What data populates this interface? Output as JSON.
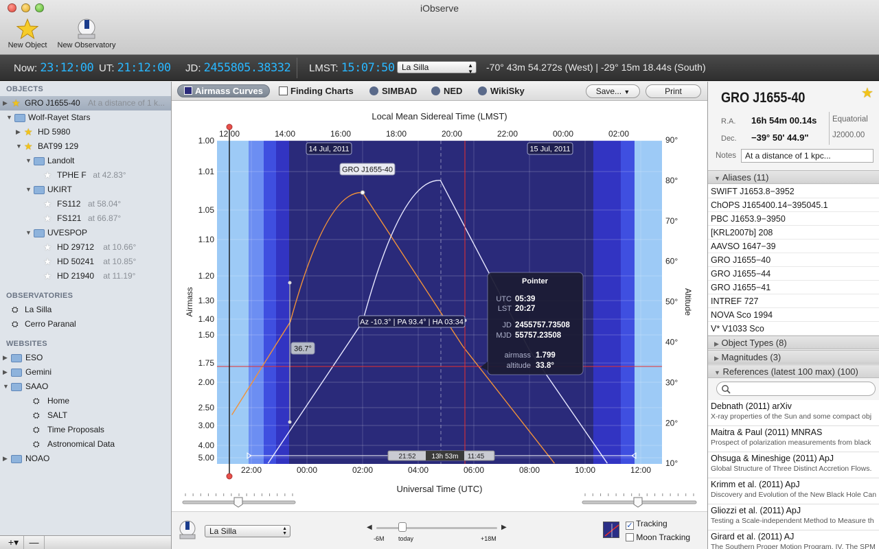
{
  "window": {
    "title": "iObserve"
  },
  "toolbar": {
    "new_object": "New Object",
    "new_observatory": "New Observatory"
  },
  "timebar": {
    "now_label": "Now:",
    "now_value": "23:12:00",
    "ut_label": "UT:",
    "ut_value": "21:12:00",
    "jd_label": "JD:",
    "jd_value": "2455805.38332",
    "lmst_label": "LMST:",
    "lmst_value": "15:07:50",
    "observatory": "La Silla",
    "coordinates": "-70° 43m 54.272s (West) | -29° 15m 18.44s (South)"
  },
  "sidebar": {
    "objects_header": "OBJECTS",
    "selected": {
      "name": "GRO J1655-40",
      "note": "At a distance of 1 k..."
    },
    "tree": [
      {
        "label": "Wolf-Rayet Stars",
        "kind": "folder",
        "indent": 0,
        "extra": ""
      },
      {
        "label": "HD 5980",
        "kind": "star-y",
        "indent": 1,
        "extra": ""
      },
      {
        "label": "BAT99 129",
        "kind": "star-y",
        "indent": 1,
        "extra": ""
      },
      {
        "label": "Landolt",
        "kind": "folder",
        "indent": 2,
        "extra": ""
      },
      {
        "label": "TPHE F",
        "kind": "star-w",
        "indent": 3,
        "extra": "at 42.83°"
      },
      {
        "label": "UKIRT",
        "kind": "folder",
        "indent": 2,
        "extra": ""
      },
      {
        "label": "FS112",
        "kind": "star-w",
        "indent": 3,
        "extra": "at 58.04°"
      },
      {
        "label": "FS121",
        "kind": "star-w",
        "indent": 3,
        "extra": "at 66.87°"
      },
      {
        "label": "UVESPOP",
        "kind": "folder",
        "indent": 2,
        "extra": ""
      },
      {
        "label": "HD 29712",
        "kind": "star-w",
        "indent": 3,
        "extra": "at 10.66°"
      },
      {
        "label": "HD 50241",
        "kind": "star-w",
        "indent": 3,
        "extra": "at 10.85°"
      },
      {
        "label": "HD 21940",
        "kind": "star-w",
        "indent": 3,
        "extra": "at 11.19°"
      }
    ],
    "observatories_header": "OBSERVATORIES",
    "observatories": [
      "La Silla",
      "Cerro Paranal"
    ],
    "websites_header": "WEBSITES",
    "websites": [
      {
        "label": "ESO",
        "kind": "folder",
        "indent": 0
      },
      {
        "label": "Gemini",
        "kind": "folder",
        "indent": 0
      },
      {
        "label": "SAAO",
        "kind": "folder",
        "indent": 0
      },
      {
        "label": "Home",
        "kind": "page",
        "indent": 1
      },
      {
        "label": "SALT",
        "kind": "page",
        "indent": 1
      },
      {
        "label": "Time Proposals",
        "kind": "page",
        "indent": 1
      },
      {
        "label": "Astronomical Data",
        "kind": "page",
        "indent": 1
      },
      {
        "label": "NOAO",
        "kind": "folder",
        "indent": 0
      }
    ],
    "add_label": "+▾",
    "remove_label": "—"
  },
  "center_toolbar": {
    "airmass": "Airmass Curves",
    "finding": "Finding Charts",
    "simbad": "SIMBAD",
    "ned": "NED",
    "wikisky": "WikiSky",
    "save": "Save...",
    "print": "Print"
  },
  "chart_data": {
    "type": "line",
    "title": "Local Mean Sidereal Time (LMST)",
    "xlabel": "Universal Time (UTC)",
    "ylabel_left": "Airmass",
    "ylabel_right": "Altitude",
    "x_ticks_bottom": [
      "22:00",
      "00:00",
      "02:00",
      "04:00",
      "06:00",
      "08:00",
      "10:00",
      "12:00"
    ],
    "x_ticks_top": [
      "12:00",
      "14:00",
      "16:00",
      "18:00",
      "20:00",
      "22:00",
      "00:00",
      "02:00"
    ],
    "airmass_ticks": [
      "1.00",
      "1.01",
      "1.05",
      "1.10",
      "1.20",
      "1.30",
      "1.40",
      "1.50",
      "1.75",
      "2.00",
      "2.50",
      "3.00",
      "4.00",
      "5.00"
    ],
    "altitude_ticks": [
      "90°",
      "80°",
      "70°",
      "60°",
      "50°",
      "40°",
      "30°",
      "20°",
      "10°"
    ],
    "date_labels": [
      "14 Jul, 2011",
      "15 Jul, 2011"
    ],
    "series": [
      {
        "name": "GRO J1655-40",
        "color": "#f0923a",
        "peak_utc": "02:00",
        "peak_altitude": 77,
        "points": [
          [
            21.3,
            22
          ],
          [
            23.4,
            45
          ],
          [
            2.0,
            77
          ],
          [
            5.6,
            39
          ],
          [
            8.9,
            10
          ]
        ]
      },
      {
        "color": "#e8e8ff",
        "peak_utc": "04:50",
        "peak_altitude": 80,
        "points": [
          [
            22.6,
            10
          ],
          [
            2.0,
            45
          ],
          [
            4.8,
            80
          ],
          [
            8.0,
            38
          ],
          [
            10.8,
            10
          ]
        ]
      }
    ],
    "target_label": "GRO J1655-40",
    "pointer": {
      "title": "Pointer",
      "utc": "05:39",
      "lst": "20:27",
      "jd": "2455757.73508",
      "mjd": "55757.23508",
      "airmass": "1.799",
      "altitude": "33.8°"
    },
    "pointer_info": "Az -10.3° | PA 93.4° | HA 03:34",
    "angle_label": "36.7°",
    "night_span": {
      "start": "21:52",
      "length": "13h 53m",
      "end": "11:45"
    },
    "colors": {
      "night": "#2a2a7a",
      "twilight": "#3f4fe0",
      "day": "#9dcaf6",
      "cursor": "#e8302e"
    }
  },
  "bottom_controls": {
    "observatory": "La Silla",
    "minus_label": "-6M",
    "today_label": "today",
    "plus_label": "+18M",
    "tracking_label": "Tracking",
    "tracking_checked": true,
    "moon_tracking_label": "Moon Tracking",
    "moon_tracking_checked": false
  },
  "right_panel": {
    "object_name": "GRO J1655-40",
    "ra_label": "R.A.",
    "ra_value": "16h 54m 00.14s",
    "dec_label": "Dec.",
    "dec_value": "−39° 50' 44.9\"",
    "frame": "Equatorial",
    "epoch": "J2000.00",
    "notes_label": "Notes",
    "notes_value": "At a distance of 1 kpc...",
    "aliases_header": "Aliases (11)",
    "aliases": [
      "SWIFT J1653.8−3952",
      "ChOPS J165400.14−395045.1",
      "PBC J1653.9−3950",
      "[KRL2007b] 208",
      "AAVSO 1647−39",
      "GRO J1655−40",
      "GRO J1655−44",
      "GRO J1655−41",
      "INTREF  727",
      "NOVA Sco 1994",
      "V* V1033 Sco"
    ],
    "object_types_header": "Object Types (8)",
    "magnitudes_header": "Magnitudes (3)",
    "references_header": "References (latest 100 max) (100)",
    "references": [
      {
        "title": "Debnath (2011) arXiv",
        "subtitle": "X-ray properties of the Sun and some compact obj"
      },
      {
        "title": "Maitra & Paul (2011) MNRAS",
        "subtitle": "Prospect of polarization measurements from black"
      },
      {
        "title": "Ohsuga & Mineshige (2011) ApJ",
        "subtitle": "Global Structure of Three Distinct Accretion Flows."
      },
      {
        "title": "Krimm et al. (2011) ApJ",
        "subtitle": "Discovery and Evolution of the New Black Hole Can"
      },
      {
        "title": "Gliozzi et al. (2011) ApJ",
        "subtitle": "Testing a Scale-independent Method to Measure th"
      },
      {
        "title": "Girard et al. (2011) AJ",
        "subtitle": "The Southern Proper Motion Program. IV. The SPM"
      }
    ]
  }
}
